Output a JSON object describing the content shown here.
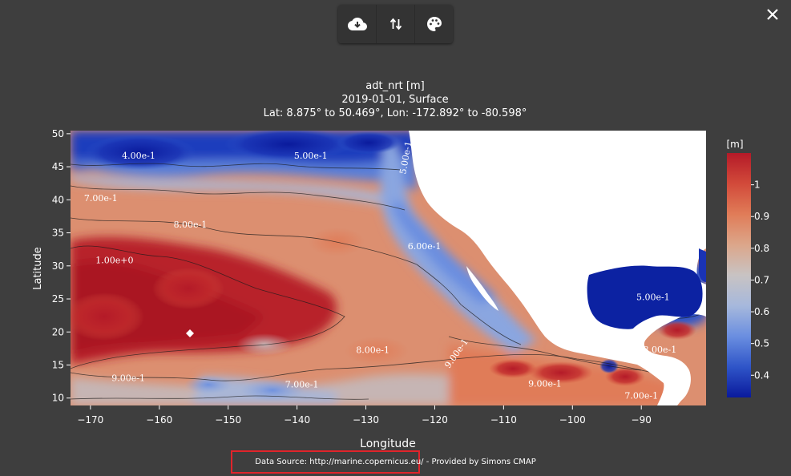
{
  "toolbar": {
    "buttons": [
      {
        "icon": "cloud-download-icon"
      },
      {
        "icon": "swap-vertical-icon"
      },
      {
        "icon": "palette-icon"
      }
    ],
    "close_icon": "close-icon"
  },
  "chart_data": {
    "type": "heatmap",
    "title": "adt_nrt [m]",
    "subtitle_1": "2019-01-01, Surface",
    "subtitle_2": "Lat: 8.875° to 50.469°, Lon: -172.892° to -80.598°",
    "xlabel": "Longitude",
    "ylabel": "Latitude",
    "xlim": [
      -172.892,
      -80.598
    ],
    "ylim": [
      8.875,
      50.469
    ],
    "x_ticks": [
      -170,
      -160,
      -150,
      -140,
      -130,
      -120,
      -110,
      -100,
      -90
    ],
    "y_ticks": [
      10,
      15,
      20,
      25,
      30,
      35,
      40,
      45,
      50
    ],
    "colorbar": {
      "title": "[m]",
      "range": [
        0.33,
        1.1
      ],
      "ticks": [
        0.4,
        0.5,
        0.6,
        0.7,
        0.8,
        0.9,
        1
      ],
      "tick_labels": [
        "0.4",
        "0.5",
        "0.6",
        "0.7",
        "0.8",
        "0.9",
        "1"
      ],
      "colors": [
        "#0a1a9c",
        "#2f55c8",
        "#6a8ee0",
        "#a6b8dc",
        "#c8c3c3",
        "#dca68a",
        "#e07c58",
        "#d24a3a",
        "#b41a28"
      ]
    },
    "contour_labels": [
      {
        "text": "4.00e-1",
        "lon": -163,
        "lat": 46.2
      },
      {
        "text": "5.00e-1",
        "lon": -138,
        "lat": 46.2
      },
      {
        "text": "5.00e-1",
        "lon": -123.8,
        "lat": 46.3
      },
      {
        "text": "7.00e-1",
        "lon": -168.5,
        "lat": 39.8
      },
      {
        "text": "8.00e-1",
        "lon": -155.5,
        "lat": 35.8
      },
      {
        "text": "6.00e-1",
        "lon": -121.5,
        "lat": 32.5
      },
      {
        "text": "1.00e+0",
        "lon": -166.5,
        "lat": 30.4
      },
      {
        "text": "5.00e-1",
        "lon": -88.3,
        "lat": 24.8
      },
      {
        "text": "8.00e-1",
        "lon": -129,
        "lat": 16.8
      },
      {
        "text": "9.00e-1",
        "lon": -116.5,
        "lat": 16.5
      },
      {
        "text": "8.00e-1",
        "lon": -87.3,
        "lat": 16.9
      },
      {
        "text": "9.00e-1",
        "lon": -164.5,
        "lat": 12.6
      },
      {
        "text": "7.00e-1",
        "lon": -139.3,
        "lat": 11.6
      },
      {
        "text": "9.00e-1",
        "lon": -104,
        "lat": 11.7
      },
      {
        "text": "7.00e-1",
        "lon": -90,
        "lat": 9.9
      }
    ]
  },
  "footer": {
    "source_label": "Data Source:",
    "source_url": "http://marine.copernicus.eu/",
    "provider": " - Provided by Simons CMAP"
  }
}
